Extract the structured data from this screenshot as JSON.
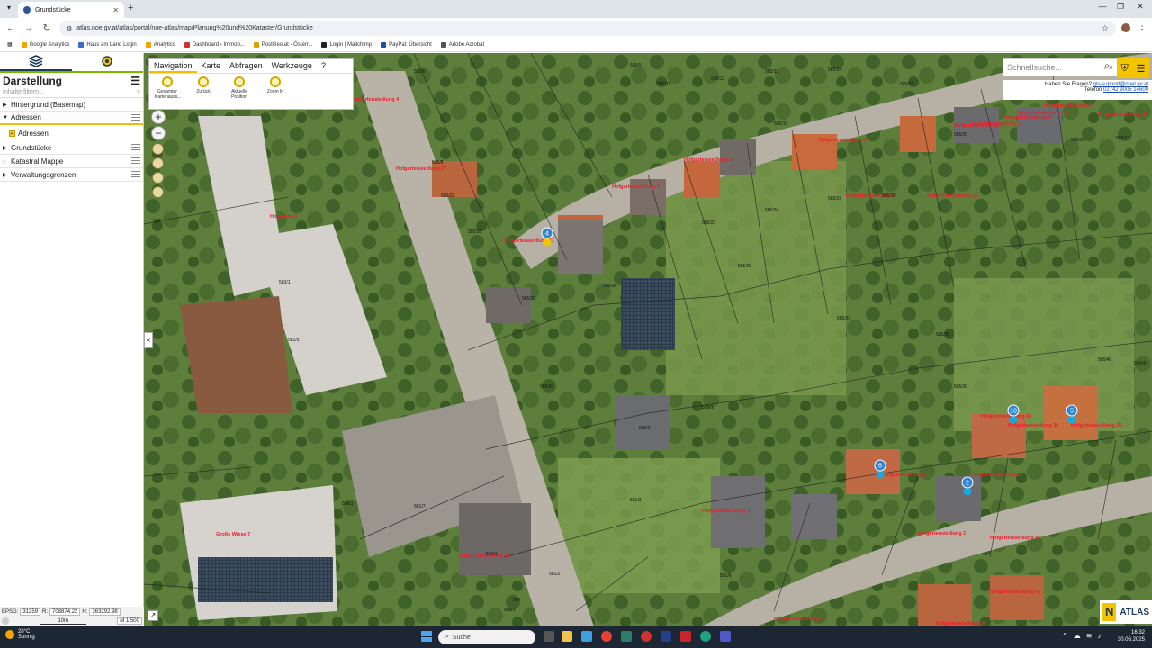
{
  "browser": {
    "tab_title": "Grundstücke",
    "url": "atlas.noe.gv.at/atlas/portal/noe-atlas/map/Planung%20und%20Kataster/Grundstücke",
    "bookmarks": [
      "Google Analytics",
      "Haus am Land Login",
      "Analytics",
      "Dashboard ‹ Immob...",
      "PostGeo.at - Österr...",
      "Login | Mailchimp",
      "PayPal: Übersicht",
      "Adobe Acrobat"
    ]
  },
  "sidebar": {
    "title": "Darstellung",
    "filter_placeholder": "Inhalte filtern...",
    "layers": [
      {
        "label": "Hintergrund (Basemap)"
      },
      {
        "label": "Adressen"
      },
      {
        "label": "Grundstücke"
      },
      {
        "label": "Katastral Mappe"
      },
      {
        "label": "Verwaltungsgrenzen"
      }
    ],
    "sub_adressen": "Adressen"
  },
  "coords": {
    "epsg_label": "EPSG:",
    "epsg": "31259",
    "r_label": "R:",
    "r": "708874.22",
    "h_label": "H:",
    "h": "363292.98",
    "scale_bar": "10m",
    "scale": "M 1:500"
  },
  "nav": {
    "tabs": [
      "Navigation",
      "Karte",
      "Abfragen",
      "Werkzeuge",
      "?"
    ],
    "tools": [
      "Gesamter Kartenauss...",
      "Zurück",
      "Aktuelle Position",
      "Zoom In"
    ]
  },
  "search": {
    "placeholder": "Schnellsuche..."
  },
  "help": {
    "question": "Haben Sie Fragen?",
    "email": "gis-support@noel.gv.at",
    "phone_label": "Telefon",
    "phone": "02742 9005 14600"
  },
  "atlas_logo": "ATLAS",
  "map": {
    "street_labels": [
      "Hofgartensiedlung 4",
      "Hofgartensiedlung 6",
      "Hofgartensiedlung 8",
      "Hofgartensiedlung 1",
      "Hofgartensiedlung 3",
      "Hofgartensiedlung 5",
      "Hofgartensiedlung 11",
      "Hofgartensiedlung 13",
      "Hofgartensiedlung 15",
      "Hofgartensiedlung 17",
      "Hofgartensiedlung 19",
      "Hofgartensiedlung 21",
      "Hofgartensiedlung 23",
      "Hofgartensiedlung 27",
      "Hofgartensiedlung 2",
      "Hofgartensiedlung 29",
      "Hofgartensiedlung 31",
      "Hofgartensiedlung 33",
      "Hofgartensiedlung 35",
      "Hofgartensiedlung 36",
      "Hofgartensiedlung 37",
      "Hofgartensiedlung 42",
      "Hofgartensiedlung 43",
      "Hofgartensiedlung 44",
      "Hofgartensiedlung 45",
      "Hofgartensiedlung 46",
      "Hofgarten 1",
      "Große Wiese 7"
    ],
    "parcel_labels": [
      "585/6",
      "585/5",
      "585/8",
      "585/11",
      "585/12",
      "585/13",
      "585/14",
      "585/15",
      "585/16",
      "585/17",
      "585/19",
      "585/20",
      "585/22",
      "585/23",
      "585/24",
      "585/26",
      "585/28",
      "585/29",
      "585/33",
      "585/34",
      "585/35",
      "585/36",
      "585/37",
      "585/38",
      "585/39",
      "585/40",
      "585/41",
      "585/1",
      "585/2",
      "581/1",
      "581/2",
      "581/3",
      "581/6",
      "581/7",
      "586/1",
      "552",
      "583/1",
      "584/1",
      "587",
      "588/1",
      "581/5"
    ],
    "pins": [
      "4",
      "6",
      "10",
      "5",
      "2"
    ]
  },
  "taskbar": {
    "weather_temp": "28°C",
    "weather_desc": "Sonnig",
    "search": "Suche",
    "time": "16:32",
    "date": "30.06.2025"
  }
}
